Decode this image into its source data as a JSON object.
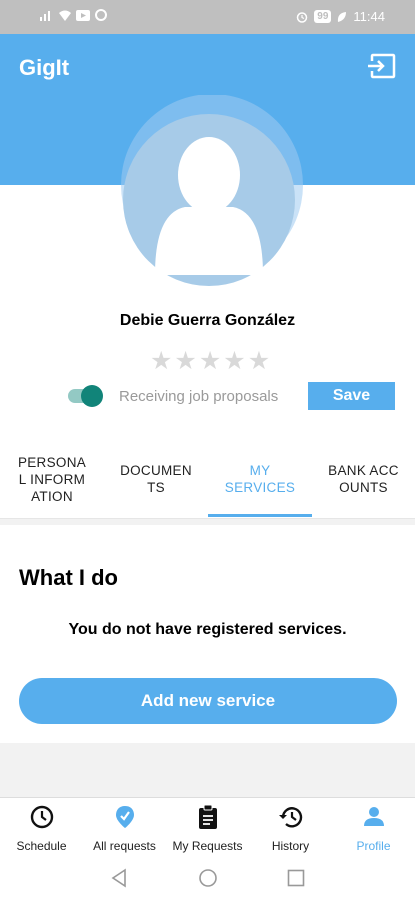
{
  "status_bar": {
    "battery": "99",
    "time": "11:44"
  },
  "app": {
    "title": "GigIt"
  },
  "profile": {
    "name": "Debie Guerra González",
    "rating": 0,
    "rating_max": 5,
    "toggle_label": "Receiving job proposals",
    "toggle_on": true,
    "save_label": "Save"
  },
  "tabs": [
    {
      "line1": "PERSONA",
      "line2": "L INFORM",
      "line3": "ATION",
      "active": false
    },
    {
      "line1": "DOCUMEN",
      "line2": "TS",
      "active": false
    },
    {
      "line1": "MY",
      "line2": "SERVICES",
      "active": true
    },
    {
      "line1": "BANK ACC",
      "line2": "OUNTS",
      "active": false
    }
  ],
  "services": {
    "title": "What I do",
    "empty_message": "You do not have registered services.",
    "add_label": "Add new service"
  },
  "bottom_nav": [
    {
      "label": "Schedule",
      "icon": "clock-icon"
    },
    {
      "label": "All requests",
      "icon": "location-pin-icon"
    },
    {
      "label": "My Requests",
      "icon": "clipboard-icon"
    },
    {
      "label": "History",
      "icon": "history-icon"
    },
    {
      "label": "Profile",
      "icon": "person-icon",
      "active": true
    }
  ],
  "colors": {
    "primary": "#57aeed",
    "toggle": "#118479"
  }
}
